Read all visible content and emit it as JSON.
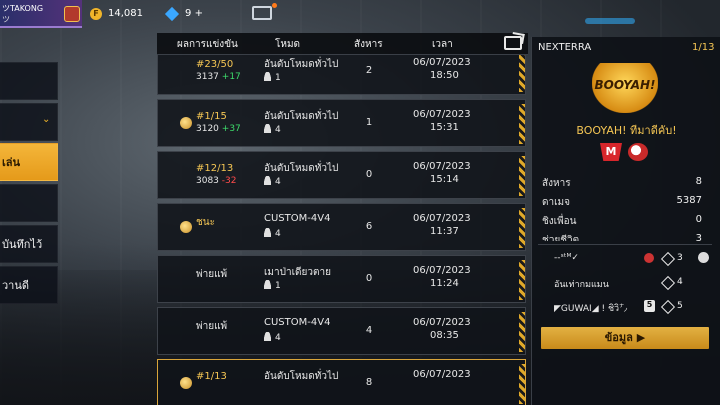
{
  "topbar": {
    "player_name": "ツTAKONG",
    "player_sub": "ツ",
    "coins": "14,081",
    "coin_symbol": "F",
    "diamonds": "9",
    "diamonds_plus": "+"
  },
  "left_menu": {
    "items": [
      {
        "label": ""
      },
      {
        "label": ""
      },
      {
        "label": "เล่น"
      },
      {
        "label": ""
      },
      {
        "label": "บันทึกไว้"
      },
      {
        "label": "วานดี"
      }
    ],
    "active_index": 2,
    "chevron": "⌄"
  },
  "table": {
    "headers": {
      "result": "ผลการแข่งขัน",
      "mode": "โหมด",
      "kills": "สังหาร",
      "time": "เวลา"
    },
    "rows": [
      {
        "medal": false,
        "rank": "#23/50",
        "rank_plain": false,
        "score": "3137",
        "delta": "+17",
        "delta_dir": "up",
        "mode": "อันดับโหมดทั่วไป",
        "players": "1",
        "kills": "2",
        "date": "06/07/2023",
        "time": "18:50",
        "highlight": false
      },
      {
        "medal": true,
        "rank": "#1/15",
        "rank_plain": false,
        "score": "3120",
        "delta": "+37",
        "delta_dir": "up",
        "mode": "อันดับโหมดทั่วไป",
        "players": "4",
        "kills": "1",
        "date": "06/07/2023",
        "time": "15:31",
        "highlight": false
      },
      {
        "medal": false,
        "rank": "#12/13",
        "rank_plain": false,
        "score": "3083",
        "delta": "-32",
        "delta_dir": "down",
        "mode": "อันดับโหมดทั่วไป",
        "players": "4",
        "kills": "0",
        "date": "06/07/2023",
        "time": "15:14",
        "highlight": false
      },
      {
        "medal": true,
        "rank": "ชนะ",
        "rank_plain": false,
        "score": "",
        "delta": "",
        "delta_dir": "",
        "mode": "CUSTOM-4V4",
        "players": "4",
        "kills": "6",
        "date": "06/07/2023",
        "time": "11:37",
        "highlight": false
      },
      {
        "medal": false,
        "rank": "พ่ายแพ้",
        "rank_plain": true,
        "score": "",
        "delta": "",
        "delta_dir": "",
        "mode": "เมาป่าเดียวตาย",
        "players": "1",
        "kills": "0",
        "date": "06/07/2023",
        "time": "11:24",
        "highlight": false
      },
      {
        "medal": false,
        "rank": "พ่ายแพ้",
        "rank_plain": true,
        "score": "",
        "delta": "",
        "delta_dir": "",
        "mode": "CUSTOM-4V4",
        "players": "4",
        "kills": "4",
        "date": "06/07/2023",
        "time": "08:35",
        "highlight": false
      },
      {
        "medal": true,
        "rank": "#1/13",
        "rank_plain": false,
        "score": "",
        "delta": "",
        "delta_dir": "",
        "mode": "อันดับโหมดทั่วไป",
        "players": "",
        "kills": "8",
        "date": "06/07/2023",
        "time": "",
        "highlight": true
      }
    ]
  },
  "panel": {
    "name": "NEXTERRA",
    "page": "1/13",
    "logo_text": "BOOYAH!",
    "title": "BOOYAH! ทีมาดีคับ!",
    "team_logo_text": "M",
    "stats": [
      {
        "label": "สังหาร",
        "value": "8"
      },
      {
        "label": "ดาเมจ",
        "value": "5387"
      },
      {
        "label": "ชิงเพื่อน",
        "value": "0"
      },
      {
        "label": "ช่วยชีวิต",
        "value": "3"
      }
    ],
    "members": [
      {
        "name": "--ˢᵗᴹ✓",
        "kills": "3",
        "badge": "red",
        "badge_text": ""
      },
      {
        "name": "อันเท่ากมแมน",
        "kills": "4",
        "badge": "plain",
        "badge_text": ""
      },
      {
        "name": "◤GUWAI◢ ! ชิวิ㌨",
        "kills": "5",
        "badge": "num",
        "badge_text": "5"
      }
    ],
    "info_button": "ข้อมูล ▶"
  }
}
